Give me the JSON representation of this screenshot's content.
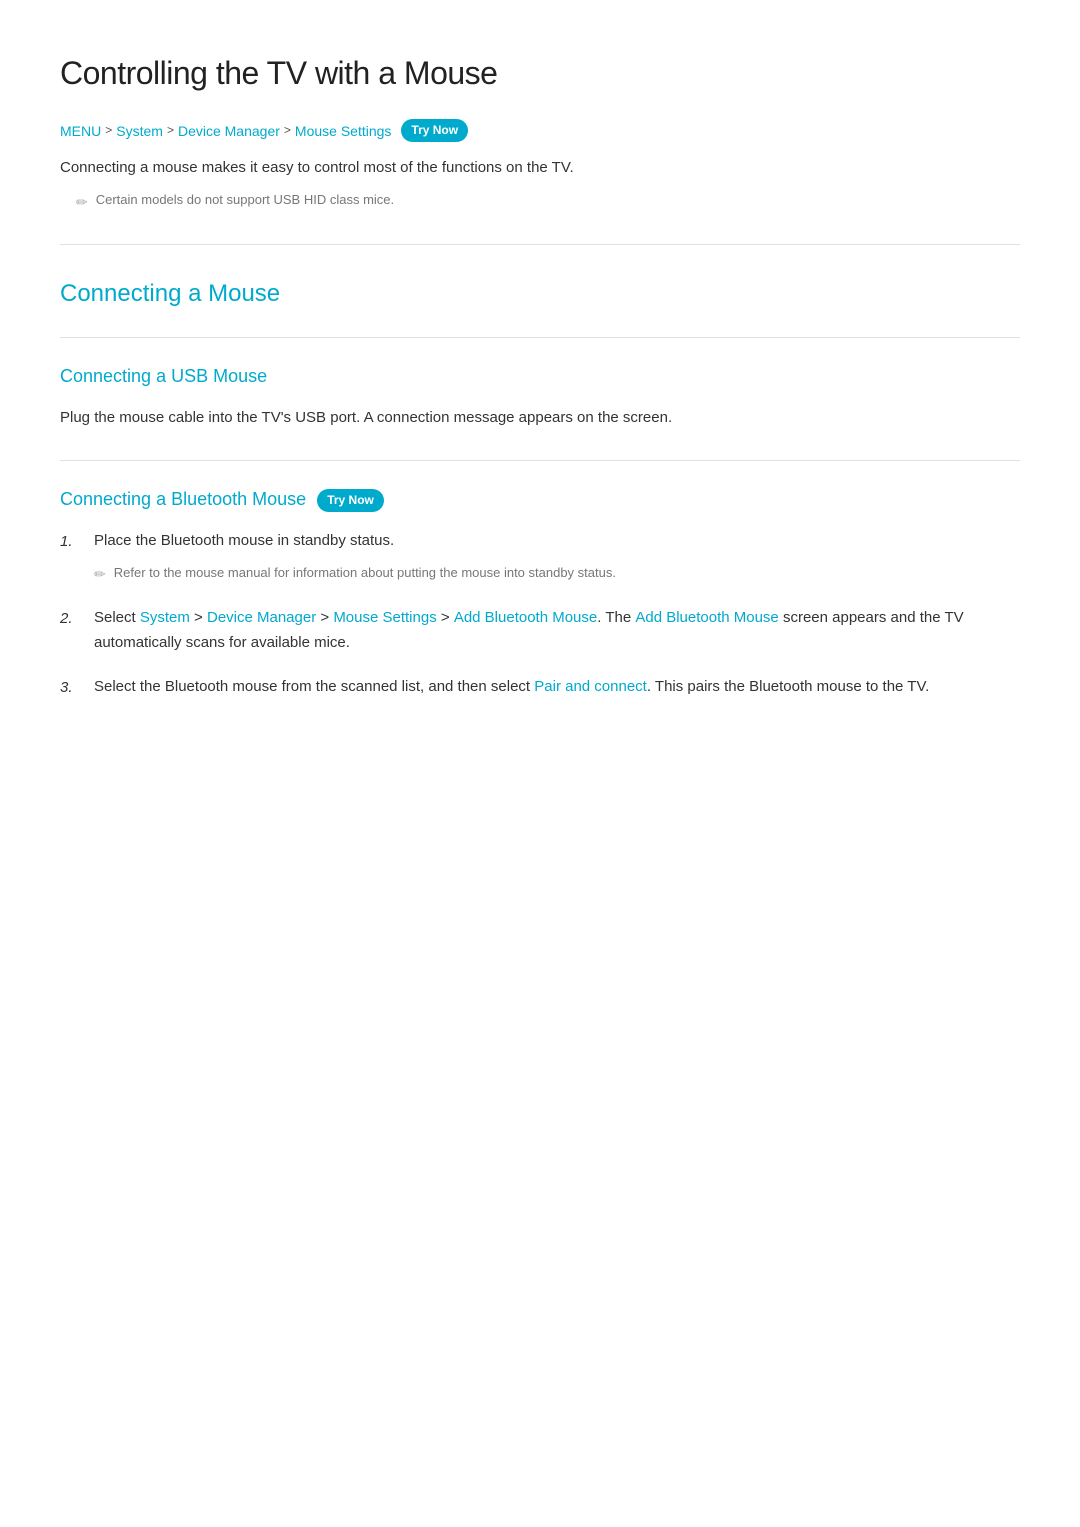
{
  "page": {
    "title": "Controlling the TV with a Mouse",
    "breadcrumb": {
      "items": [
        {
          "label": "MENU",
          "link": true
        },
        {
          "label": "System",
          "link": true
        },
        {
          "label": "Device Manager",
          "link": true
        },
        {
          "label": "Mouse Settings",
          "link": true
        }
      ],
      "separator": ">",
      "try_now_label": "Try Now"
    },
    "intro_text": "Connecting a mouse makes it easy to control most of the functions on the TV.",
    "note_text": "Certain models do not support USB HID class mice.",
    "sections": [
      {
        "id": "connecting-a-mouse",
        "title": "Connecting a Mouse",
        "subsections": [
          {
            "id": "usb-mouse",
            "title": "Connecting a USB Mouse",
            "try_now": false,
            "body": "Plug the mouse cable into the TV's USB port. A connection message appears on the screen.",
            "note": null,
            "steps": []
          },
          {
            "id": "bluetooth-mouse",
            "title": "Connecting a Bluetooth Mouse",
            "try_now": true,
            "try_now_label": "Try Now",
            "body": null,
            "note": null,
            "steps": [
              {
                "text": "Place the Bluetooth mouse in standby status.",
                "note": "Refer to the mouse manual for information about putting the mouse into standby status."
              },
              {
                "text_parts": [
                  {
                    "text": "Select ",
                    "link": false
                  },
                  {
                    "text": "System",
                    "link": true
                  },
                  {
                    "text": " > ",
                    "link": false
                  },
                  {
                    "text": "Device Manager",
                    "link": true
                  },
                  {
                    "text": " > ",
                    "link": false
                  },
                  {
                    "text": "Mouse Settings",
                    "link": true
                  },
                  {
                    "text": " > ",
                    "link": false
                  },
                  {
                    "text": "Add Bluetooth Mouse",
                    "link": true
                  },
                  {
                    "text": ". The ",
                    "link": false
                  },
                  {
                    "text": "Add Bluetooth Mouse",
                    "link": true
                  },
                  {
                    "text": " screen appears and the TV automatically scans for available mice.",
                    "link": false
                  }
                ],
                "note": null
              },
              {
                "text_parts": [
                  {
                    "text": "Select the Bluetooth mouse from the scanned list, and then select ",
                    "link": false
                  },
                  {
                    "text": "Pair and connect",
                    "link": true
                  },
                  {
                    "text": ". This pairs the Bluetooth mouse to the TV.",
                    "link": false
                  }
                ],
                "note": null
              }
            ]
          }
        ]
      }
    ]
  }
}
